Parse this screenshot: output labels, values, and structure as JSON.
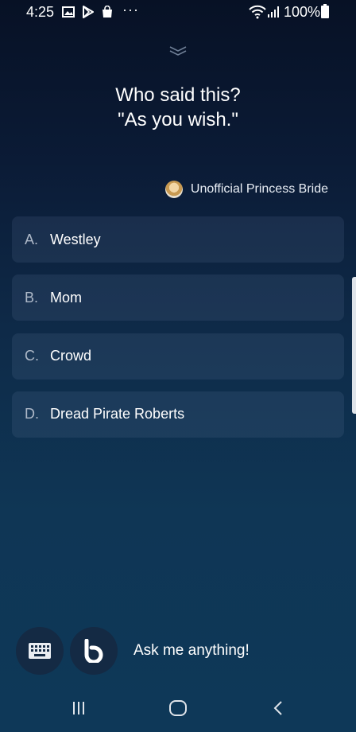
{
  "status_bar": {
    "time": "4:25",
    "notification_icons": [
      "gallery-icon",
      "play-store-icon",
      "shopping-bag-icon"
    ],
    "more": "···",
    "battery_percent": "100%"
  },
  "question": {
    "line1": "Who said this?",
    "line2": "\"As you wish.\""
  },
  "source": {
    "label": "Unofficial Princess Bride"
  },
  "answers": [
    {
      "letter": "A.",
      "text": "Westley"
    },
    {
      "letter": "B.",
      "text": "Mom"
    },
    {
      "letter": "C.",
      "text": "Crowd"
    },
    {
      "letter": "D.",
      "text": "Dread Pirate Roberts"
    }
  ],
  "input_bar": {
    "prompt": "Ask me anything!"
  },
  "colors": {
    "background_top": "#071125",
    "background_bottom": "#0e3858",
    "answer_card": "#1b3551",
    "letter": "#aeb9c8"
  }
}
